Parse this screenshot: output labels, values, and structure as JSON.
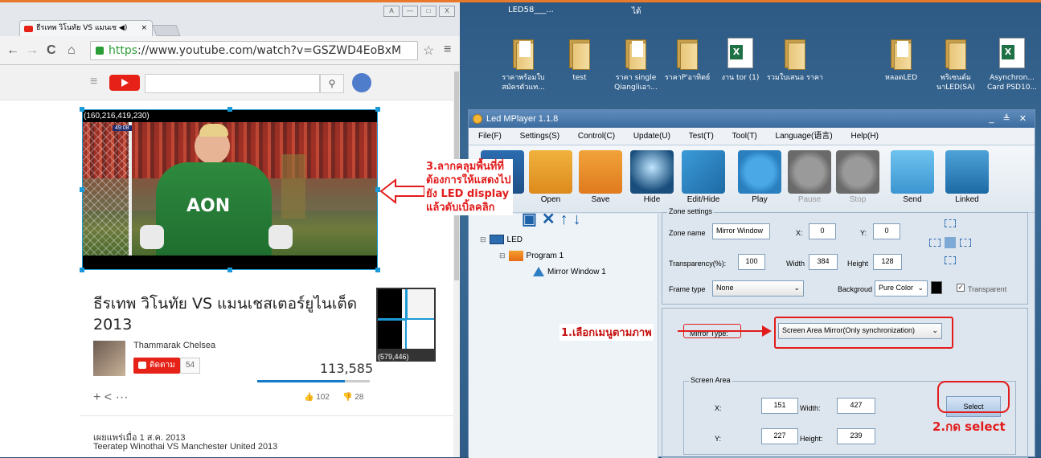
{
  "browser": {
    "tab_title": "ธีรเทพ วิโนทัย VS แมนเช ◀)",
    "tab_close": "×",
    "window_buttons": [
      "A",
      "—",
      "□",
      "X"
    ],
    "url_https": "https",
    "url_rest": "://www.youtube.com/watch?v=GSZWD4EoBxM",
    "nav": {
      "back": "←",
      "forward": "→",
      "reload": "C",
      "home": "⌂"
    }
  },
  "youtube": {
    "selection_coords": "(160,216,419,230)",
    "zoom_coords": "(579,446)",
    "video_title": "ธีรเทพ วิโนทัย VS แมนเชสเตอร์ยูไนเต็ด 2013",
    "channel": "Thammarak Chelsea",
    "subscribe_label": "ติดตาม",
    "subscriber_count": "54",
    "view_count": "113,585",
    "likes": "102",
    "dislikes": "28",
    "published": "เผยแพร่เมื่อ 1 ส.ค. 2013",
    "description": "Teeratep Winothai VS Manchester United 2013",
    "video_time_label": "49:08",
    "jersey_text": "AON"
  },
  "desktop": {
    "top_labels": [
      "LED58___...",
      "ได้"
    ],
    "icons": [
      {
        "label": "ราคาพร้อมใบ สมัครตัวแท...",
        "kind": "folder-doc"
      },
      {
        "label": "test",
        "kind": "folder"
      },
      {
        "label": "ราคา single Qiangliเอา...",
        "kind": "folder"
      },
      {
        "label": "ราคาP'อาทิตย์",
        "kind": "folder"
      },
      {
        "label": "งาน tor (1)",
        "kind": "xlsx"
      },
      {
        "label": "รวมใบเสนอ ราคา",
        "kind": "folder"
      },
      {
        "label": "หลอดLED",
        "kind": "folder"
      },
      {
        "label": "พริเซนต์ม นาLED(SA)",
        "kind": "folder"
      },
      {
        "label": "Asynchron... Card PSD10...",
        "kind": "xlsx"
      }
    ]
  },
  "ledplayer": {
    "title": "Led MPlayer 1.1.8",
    "window_controls": "_ ≜ ✕",
    "menu": [
      "File(F)",
      "Settings(S)",
      "Control(C)",
      "Update(U)",
      "Test(T)",
      "Tool(T)",
      "Language(语言)",
      "Help(H)"
    ],
    "toolbar": [
      {
        "label": "Open",
        "enabled": true
      },
      {
        "label": "Save",
        "enabled": true
      },
      {
        "label": "Hide",
        "enabled": true
      },
      {
        "label": "Edit/Hide",
        "enabled": true
      },
      {
        "label": "Play",
        "enabled": true
      },
      {
        "label": "Pause",
        "enabled": false
      },
      {
        "label": "Stop",
        "enabled": false
      },
      {
        "label": "Send",
        "enabled": true
      },
      {
        "label": "Linked",
        "enabled": true
      }
    ],
    "tree": {
      "root": "LED",
      "program": "Program 1",
      "window": "Mirror Window 1"
    },
    "zone_settings": {
      "legend": "Zone settings",
      "zone_name_label": "Zone name",
      "zone_name_value": "Mirror Window",
      "x_label": "X:",
      "x_value": "0",
      "y_label": "Y:",
      "y_value": "0",
      "transparency_label": "Transparency(%):",
      "transparency_value": "100",
      "width_label": "Width",
      "width_value": "384",
      "height_label": "Height",
      "height_value": "128",
      "frame_type_label": "Frame type",
      "frame_type_value": "None",
      "background_label": "Backgroud",
      "background_value": "Pure Color",
      "transparent_label": "Transparent"
    },
    "mirror": {
      "type_label": "Mirror Type:",
      "type_value": "Screen Area Mirror(Only synchronization)",
      "screen_area_legend": "Screen Area",
      "x_label": "X:",
      "x_value": "151",
      "width_label": "Width:",
      "width_value": "427",
      "y_label": "Y:",
      "y_value": "227",
      "height_label": "Height:",
      "height_value": "239",
      "select_label": "Select"
    }
  },
  "annotations": {
    "step1": "1.เลือกเมนูตามภาพ",
    "step2": "2.กด select",
    "step3": [
      "3.ลากคลุมพื้นที่ที่",
      "ต้องการให้แสดงไป",
      "ยัง LED display",
      "แล้วดับเบิ้ลคลิก"
    ]
  },
  "colors": {
    "annotation_red": "#e21c1c",
    "selection_blue": "#1c9ad6",
    "youtube_red": "#e62117"
  }
}
